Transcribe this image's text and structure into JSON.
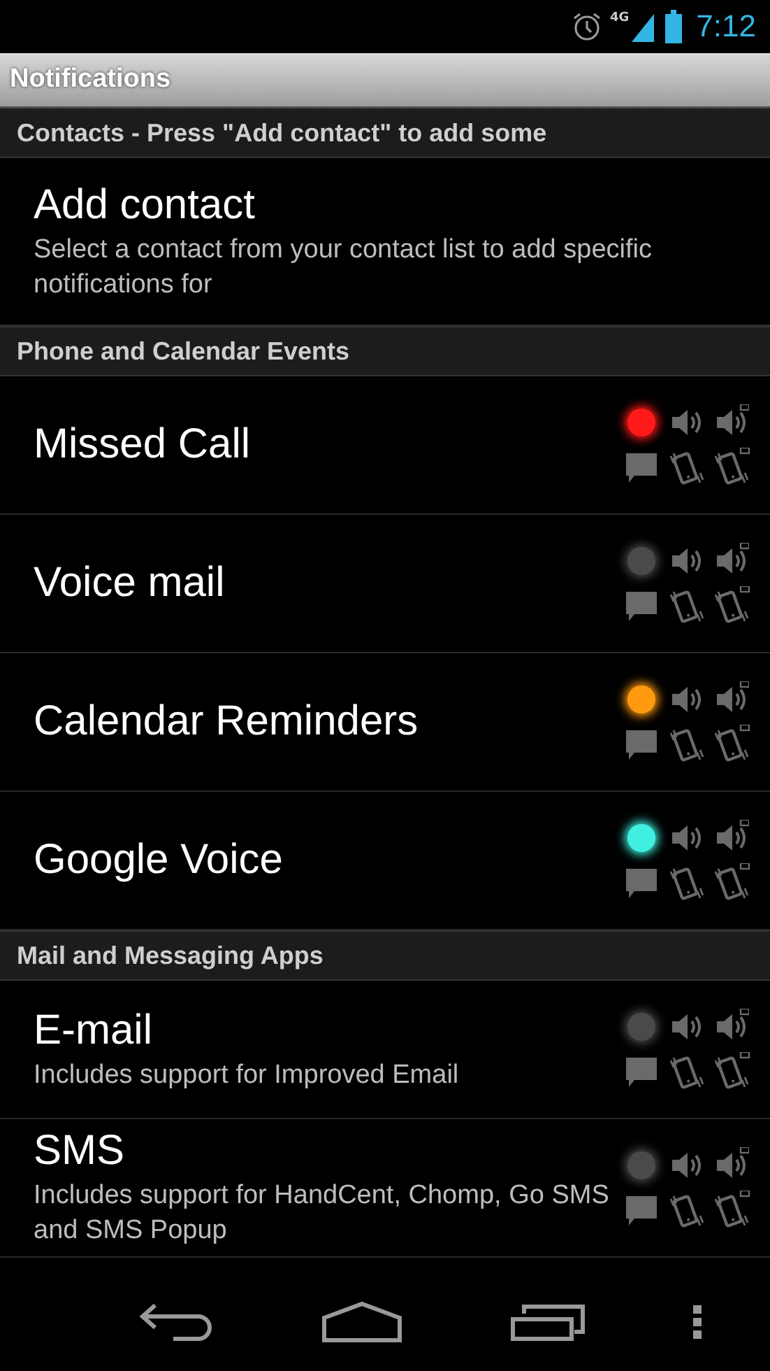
{
  "status_bar": {
    "network": "4G",
    "time": "7:12"
  },
  "title_bar": {
    "title": "Notifications"
  },
  "sections": [
    {
      "header": "Contacts - Press \"Add contact\" to add some",
      "items": [
        {
          "kind": "action",
          "title": "Add contact",
          "description": "Select a contact from your contact list to add specific notifications for"
        }
      ]
    },
    {
      "header": "Phone and Calendar Events",
      "items": [
        {
          "kind": "notification",
          "title": "Missed Call",
          "color": "#ff1a1a"
        },
        {
          "kind": "notification",
          "title": "Voice mail",
          "color": "#4a4a4a"
        },
        {
          "kind": "notification",
          "title": "Calendar Reminders",
          "color": "#ff9a10"
        },
        {
          "kind": "notification",
          "title": "Google Voice",
          "color": "#3ff0e0"
        }
      ]
    },
    {
      "header": "Mail and Messaging Apps",
      "items": [
        {
          "kind": "notification",
          "title": "E-mail",
          "description": "Includes support for Improved Email",
          "color": "#4a4a4a"
        },
        {
          "kind": "notification",
          "title": "SMS",
          "description": "Includes support for HandCent, Chomp, Go SMS and SMS Popup",
          "color": "#4a4a4a"
        }
      ]
    }
  ]
}
